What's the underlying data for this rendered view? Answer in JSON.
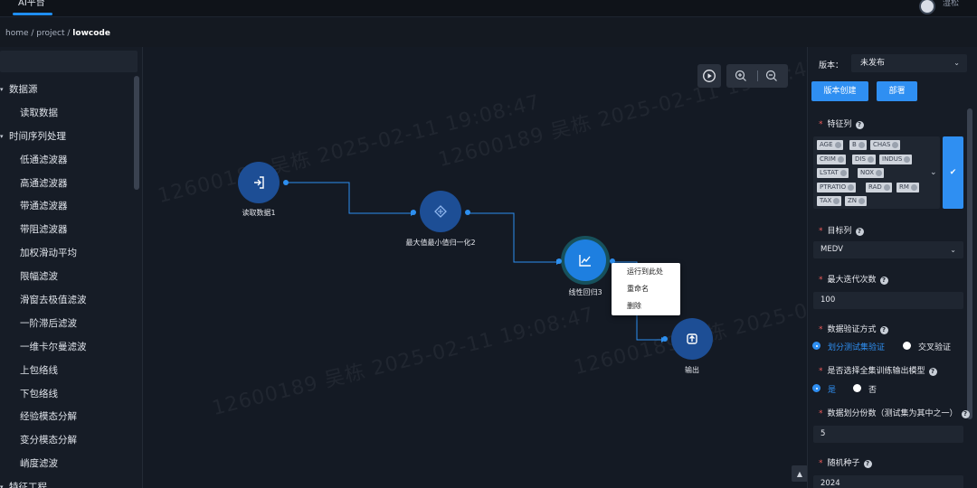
{
  "app": {
    "title": "AI平台",
    "user_name": "湿松"
  },
  "breadcrumb": {
    "home": "home",
    "sep": " / ",
    "project": "project",
    "current": "lowcode"
  },
  "sidebar": {
    "items": [
      {
        "label": "数据源",
        "type": "group"
      },
      {
        "label": "读取数据",
        "type": "leaf"
      },
      {
        "label": "时间序列处理",
        "type": "group"
      },
      {
        "label": "低通滤波器",
        "type": "leaf"
      },
      {
        "label": "高通滤波器",
        "type": "leaf"
      },
      {
        "label": "带通滤波器",
        "type": "leaf"
      },
      {
        "label": "带阻滤波器",
        "type": "leaf"
      },
      {
        "label": "加权滑动平均",
        "type": "leaf"
      },
      {
        "label": "限幅滤波",
        "type": "leaf"
      },
      {
        "label": "滑窗去极值滤波",
        "type": "leaf"
      },
      {
        "label": "一阶滞后滤波",
        "type": "leaf"
      },
      {
        "label": "一维卡尔曼滤波",
        "type": "leaf"
      },
      {
        "label": "上包络线",
        "type": "leaf"
      },
      {
        "label": "下包络线",
        "type": "leaf"
      },
      {
        "label": "经验模态分解",
        "type": "leaf"
      },
      {
        "label": "变分模态分解",
        "type": "leaf"
      },
      {
        "label": "峭度滤波",
        "type": "leaf"
      },
      {
        "label": "特征工程",
        "type": "group"
      }
    ]
  },
  "watermark": {
    "text": "12600189 吴栋 2025-02-11 19:08:47"
  },
  "canvas": {
    "nodes": [
      {
        "label": "读取数据1",
        "icon": "import-icon"
      },
      {
        "label": "最大值最小值归一化2",
        "icon": "normalize-icon"
      },
      {
        "label": "线性回归3",
        "icon": "chart-icon"
      },
      {
        "label": "输出",
        "icon": "export-icon"
      }
    ],
    "context_menu": [
      "运行到此处",
      "重命名",
      "删除"
    ],
    "scroll_top": "▲"
  },
  "panel": {
    "version_label": "版本：",
    "version_value": "未发布",
    "create_version": "版本创建",
    "deploy": "部署",
    "feature_label": "特征列",
    "features": [
      "AGE",
      "B",
      "CHAS",
      "CRIM",
      "DIS",
      "INDUS",
      "LSTAT",
      "NOX",
      "PTRATIO",
      "RAD",
      "RM",
      "TAX",
      "ZN"
    ],
    "confirm_mark": "✔",
    "target_label": "目标列",
    "target_value": "MEDV",
    "max_iter_label": "最大迭代次数",
    "max_iter_value": "100",
    "validation_label": "数据验证方式",
    "validation_options": [
      "划分测试集验证",
      "交叉验证"
    ],
    "fullset_label": "是否选择全集训练输出模型",
    "fullset_options": [
      "是",
      "否"
    ],
    "split_label": "数据划分份数（测试集为其中之一）",
    "split_value": "5",
    "seed_label": "随机种子",
    "seed_value": "2024"
  },
  "colors": {
    "accent": "#2f8ff2",
    "node": "#1d4e95",
    "node_active": "#1e7fe0",
    "background": "#141a24"
  }
}
